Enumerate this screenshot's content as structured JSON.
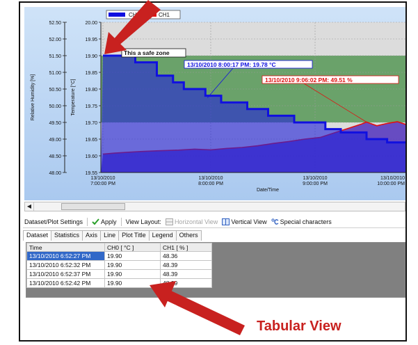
{
  "legend": {
    "ch0": "CH0",
    "ch1": "CH1"
  },
  "chart_data": {
    "type": "line",
    "xlabel": "Date/Time",
    "ylabel_left_outer": "Relative Humidity [%]",
    "ylabel_left_inner": "Temperature [°C]",
    "humidity_ticks": [
      "52.50",
      "52.00",
      "51.50",
      "51.00",
      "50.50",
      "50.00",
      "49.50",
      "49.00",
      "48.50",
      "48.00"
    ],
    "temperature_ticks": [
      "20.00",
      "19.95",
      "19.90",
      "19.85",
      "19.80",
      "19.75",
      "19.70",
      "19.65",
      "19.60",
      "19.55"
    ],
    "x_ticks": [
      [
        "13/10/2010",
        "7:00:00 PM"
      ],
      [
        "13/10/2010",
        "8:00:00 PM"
      ],
      [
        "13/10/2010",
        "9:00:00 PM"
      ],
      [
        "13/10/2010",
        "10:00:00 PM"
      ]
    ],
    "humidity_range": [
      48.0,
      52.5
    ],
    "temperature_range": [
      19.55,
      20.0
    ],
    "safe_zone_temperature": [
      19.7,
      19.9
    ],
    "zones": {
      "warning": "#dcdcdc",
      "safe": "#6aa26a"
    },
    "annotations": {
      "safe_zone": "This a safe zone",
      "ch0_point": "13/10/2010 8:00:17 PM: 19.78 °C",
      "ch1_point": "13/10/2010 9:06:02 PM: 49.51 %"
    },
    "series": [
      {
        "name": "CH0",
        "unit": "°C",
        "color": "#1010e0",
        "points": [
          [
            0.0,
            19.9
          ],
          [
            0.3,
            19.88
          ],
          [
            0.5,
            19.84
          ],
          [
            0.65,
            19.82
          ],
          [
            0.75,
            19.8
          ],
          [
            0.95,
            19.78
          ],
          [
            1.1,
            19.76
          ],
          [
            1.35,
            19.74
          ],
          [
            1.55,
            19.72
          ],
          [
            1.8,
            19.7
          ],
          [
            2.0,
            19.7
          ],
          [
            2.1,
            19.68
          ],
          [
            2.25,
            19.67
          ],
          [
            2.5,
            19.65
          ],
          [
            2.7,
            19.64
          ],
          [
            2.9,
            19.65
          ],
          [
            3.05,
            19.66
          ],
          [
            3.15,
            19.66
          ]
        ]
      },
      {
        "name": "CH1",
        "unit": "%",
        "color": "#e11010",
        "points": [
          [
            0.0,
            48.55
          ],
          [
            0.1,
            48.58
          ],
          [
            0.2,
            48.6
          ],
          [
            0.35,
            48.63
          ],
          [
            0.5,
            48.65
          ],
          [
            0.7,
            48.67
          ],
          [
            0.85,
            48.7
          ],
          [
            1.0,
            48.68
          ],
          [
            1.15,
            48.72
          ],
          [
            1.3,
            48.75
          ],
          [
            1.45,
            48.8
          ],
          [
            1.6,
            48.87
          ],
          [
            1.75,
            48.93
          ],
          [
            1.9,
            49.0
          ],
          [
            2.05,
            49.05
          ],
          [
            2.2,
            49.2
          ],
          [
            2.35,
            49.35
          ],
          [
            2.45,
            49.45
          ],
          [
            2.5,
            49.51
          ],
          [
            2.6,
            49.4
          ],
          [
            2.7,
            49.47
          ],
          [
            2.8,
            49.52
          ],
          [
            2.9,
            49.42
          ],
          [
            3.0,
            49.38
          ],
          [
            3.15,
            49.36
          ]
        ]
      }
    ]
  },
  "toolbar": {
    "settings": "Dataset/Plot Settings",
    "apply": "Apply",
    "view_layout": "View Layout:",
    "horizontal_view": "Horizontal View",
    "vertical_view": "Vertical View",
    "special_characters": "Special characters"
  },
  "tabs": [
    "Dataset",
    "Statistics",
    "Axis",
    "Line",
    "Plot Title",
    "Legend",
    "Others"
  ],
  "table": {
    "headers": [
      "Time",
      "CH0 [ °C ]",
      "CH1 [ % ]"
    ],
    "rows": [
      [
        "13/10/2010 6:52:27 PM",
        "19.90",
        "48.36"
      ],
      [
        "13/10/2010 6:52:32 PM",
        "19.90",
        "48.39"
      ],
      [
        "13/10/2010 6:52:37 PM",
        "19.90",
        "48.39"
      ],
      [
        "13/10/2010 6:52:42 PM",
        "19.90",
        "48.39"
      ]
    ]
  },
  "callout": {
    "tabular_view": "Tabular View"
  },
  "colors": {
    "arrow": "#c8211f",
    "accent": "#3168c8"
  }
}
